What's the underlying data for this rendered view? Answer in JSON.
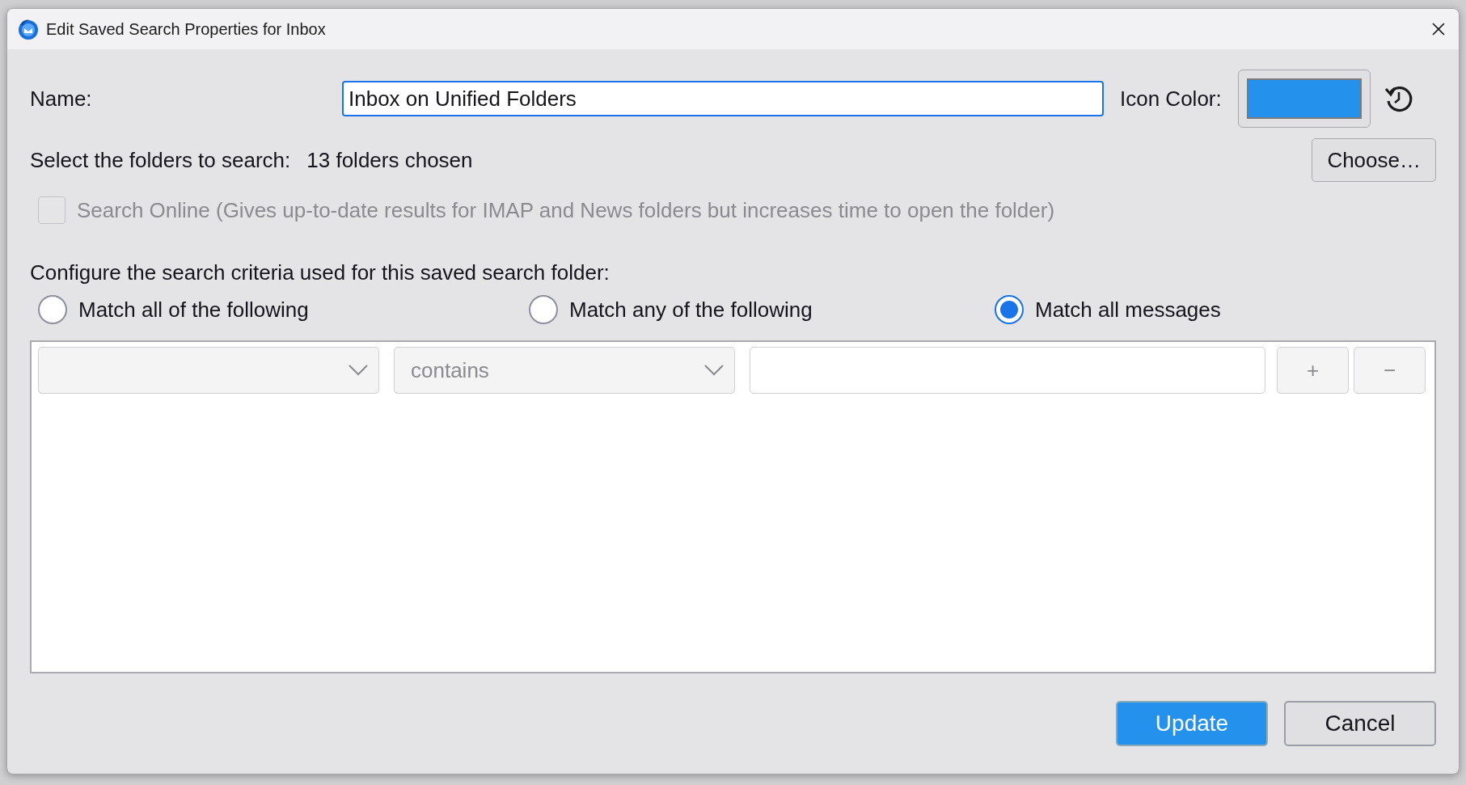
{
  "window": {
    "title": "Edit Saved Search Properties for Inbox"
  },
  "name": {
    "label": "Name:",
    "value": "Inbox on Unified Folders"
  },
  "icon_color": {
    "label": "Icon Color:",
    "color": "#2492ec"
  },
  "folders": {
    "label": "Select the folders to search:",
    "value": "13 folders chosen",
    "button": "Choose…"
  },
  "search_online": {
    "label": "Search Online (Gives up-to-date results for IMAP and News folders but increases time to open the folder)",
    "checked": false,
    "disabled": true
  },
  "criteria_label": "Configure the search criteria used for this saved search folder:",
  "match_options": [
    {
      "label": "Match all of the following",
      "selected": false
    },
    {
      "label": "Match any of the following",
      "selected": false
    },
    {
      "label": "Match all messages",
      "selected": true
    }
  ],
  "rules": [
    {
      "operator": "contains",
      "add": "+",
      "remove": "−"
    }
  ],
  "buttons": [
    {
      "label": "Update",
      "kind": "primary"
    },
    {
      "label": "Cancel",
      "kind": "secondary"
    }
  ]
}
